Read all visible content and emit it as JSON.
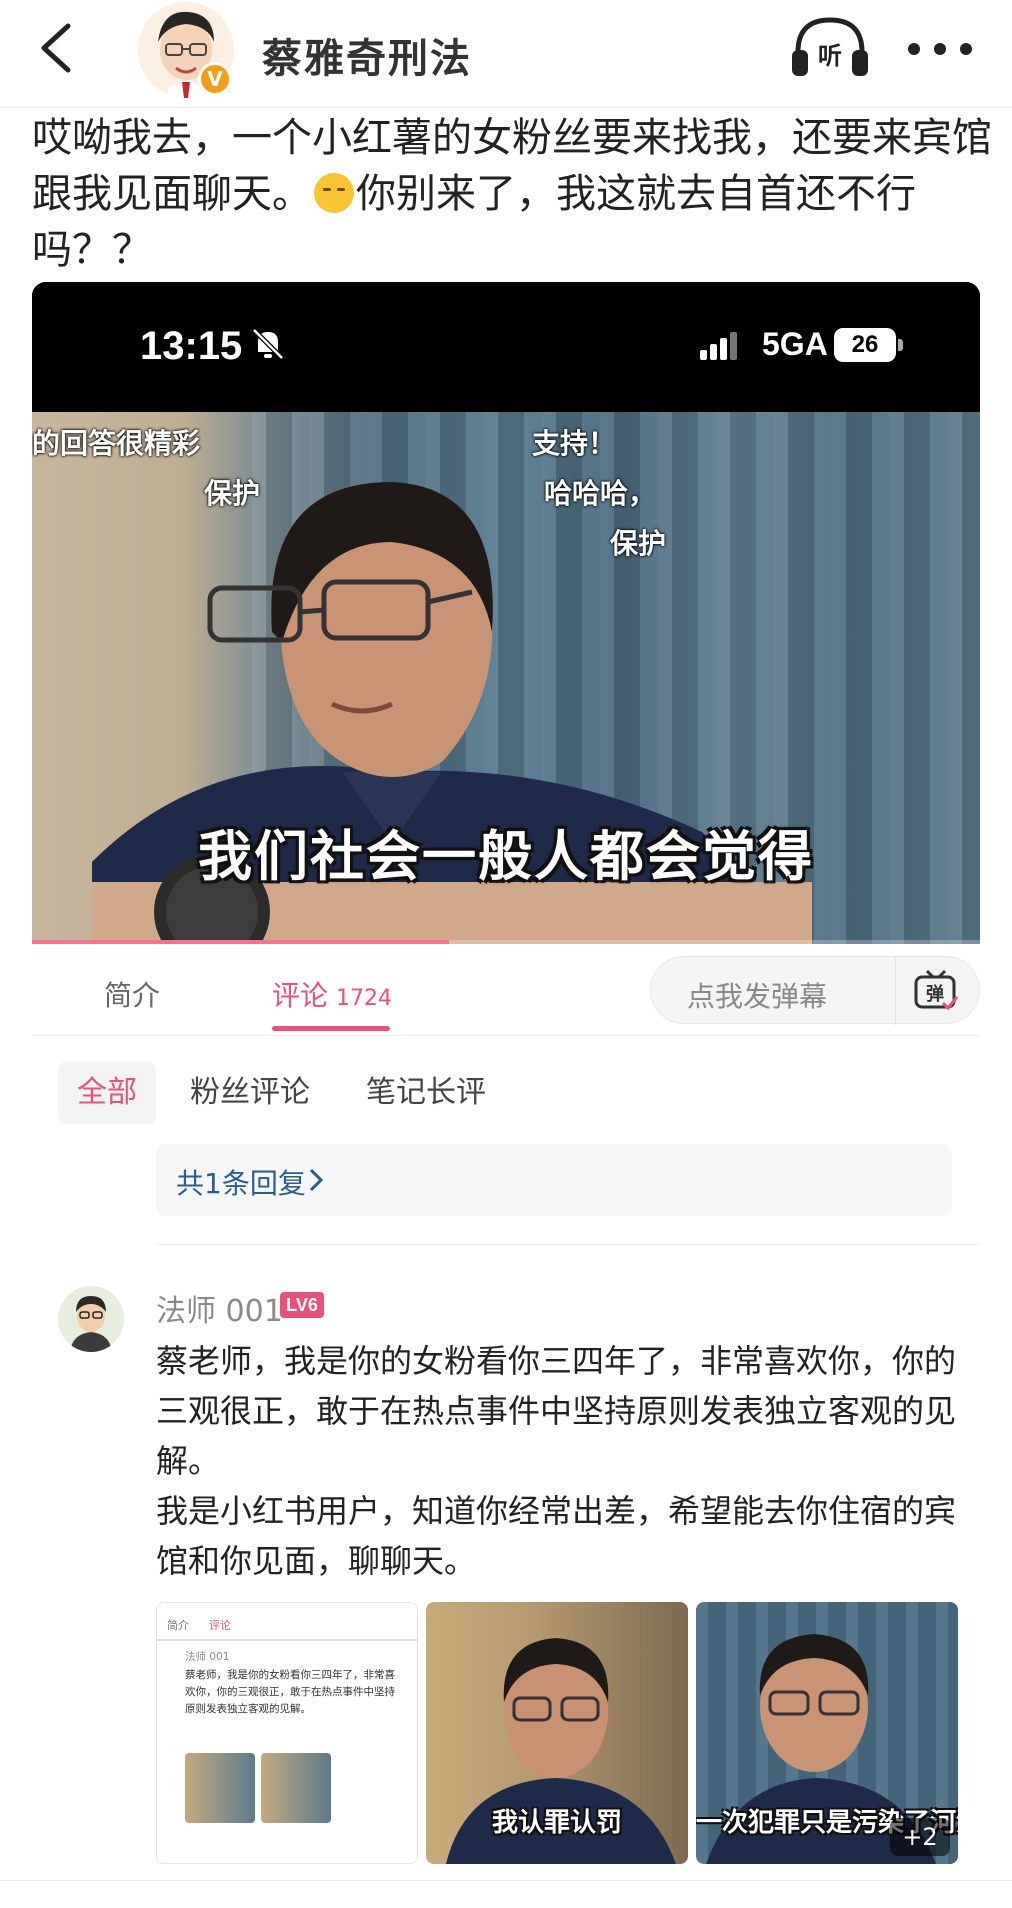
{
  "header": {
    "account_name": "蔡雅奇刑法",
    "verified_mark": "V",
    "listen_label": "听"
  },
  "post": {
    "text_part1": "哎呦我去，一个小红薯的女粉丝要来找我，还要来宾馆跟我见面聊天。",
    "text_part2": "你别来了，我这就去自首还不行吗？？",
    "emoji": "sleepy-grin-emoji"
  },
  "video": {
    "status_time": "13:15",
    "status_network": "5GA",
    "status_battery": "26",
    "danmaku": [
      "的回答很精彩",
      "保护",
      "支持！",
      "哈哈哈，",
      "保护"
    ],
    "subtitle": "我们社会一般人都会觉得",
    "progress": 0.44
  },
  "tabs": {
    "intro_label": "简介",
    "comments_label": "评论",
    "comments_count": "1724",
    "danmaku_placeholder": "点我发弹幕",
    "danmaku_button": "弹"
  },
  "filters": {
    "all": "全部",
    "fans": "粉丝评论",
    "notes": "笔记长评"
  },
  "reply_summary": "共1条回复",
  "comment": {
    "user_name": "法师 001",
    "level": "LV6",
    "text_line1": "蔡老师，我是你的女粉看你三四年了，非常喜欢你，你的三观很正，敢于在热点事件中坚持原则发表独立客观的见解。",
    "text_line2": "我是小红书用户，知道你经常出差，希望能去你住宿的宾馆和你见面，聊聊天。",
    "thumb_captions": [
      "我认罪认罚",
      "一次犯罪只是污染了河流"
    ],
    "more_images": "+2"
  },
  "colors": {
    "accent": "#e8517a",
    "link": "#2c5d8f",
    "verified": "#f59d1a"
  }
}
